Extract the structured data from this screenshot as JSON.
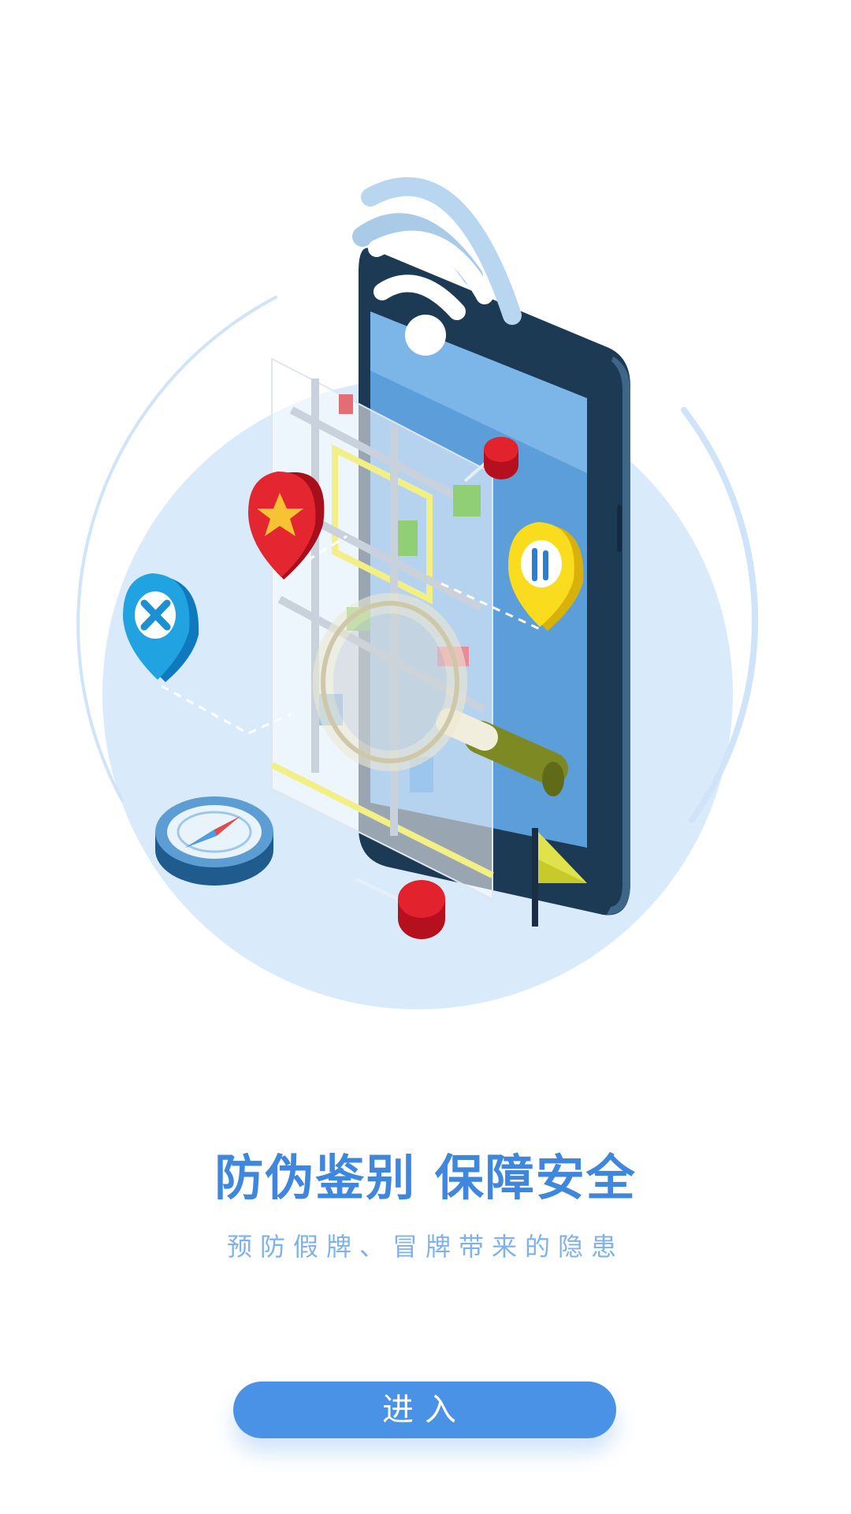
{
  "hero": {
    "title": "防伪鉴别 保障安全",
    "subtitle": "预防假牌、冒牌带来的隐患"
  },
  "enter_button": {
    "label": "进入"
  },
  "colors": {
    "accent": "#4a92e6",
    "title": "#3f86dd",
    "subtitle": "#7fb1ea",
    "circle": "#d9ebfb"
  },
  "icons": [
    "phone-illustration",
    "wifi-icon",
    "map-icon",
    "magnifier-icon",
    "star-location-pin-icon",
    "restaurant-location-pin-icon",
    "airplane-location-pin-icon",
    "compass-icon",
    "push-pin-icon",
    "flag-icon"
  ]
}
